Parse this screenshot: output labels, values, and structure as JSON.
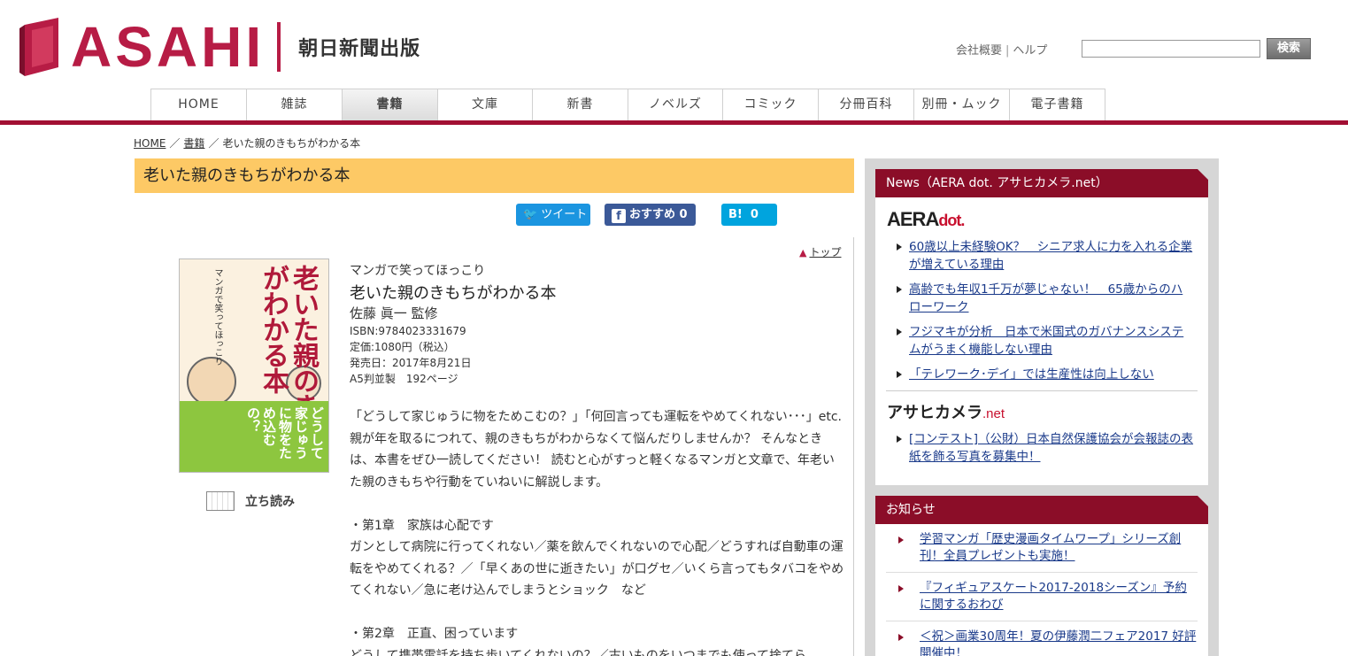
{
  "brand": {
    "logo_text": "ASAHI",
    "subtitle": "朝日新聞出版",
    "accent_color": "#b71c45"
  },
  "utility": {
    "company": "会社概要",
    "separator": "|",
    "help": "ヘルプ",
    "search_placeholder": "",
    "search_button": "検索"
  },
  "nav": {
    "items": [
      {
        "label": "HOME",
        "active": false
      },
      {
        "label": "雑誌",
        "active": false
      },
      {
        "label": "書籍",
        "active": true
      },
      {
        "label": "文庫",
        "active": false
      },
      {
        "label": "新書",
        "active": false
      },
      {
        "label": "ノベルズ",
        "active": false
      },
      {
        "label": "コミック",
        "active": false
      },
      {
        "label": "分冊百科",
        "active": false
      },
      {
        "label": "別冊・ムック",
        "active": false
      },
      {
        "label": "電子書籍",
        "active": false
      }
    ]
  },
  "breadcrumb": {
    "home": "HOME",
    "sep": "／",
    "category": "書籍",
    "current": "老いた親のきもちがわかる本"
  },
  "page_title": "老いた親のきもちがわかる本",
  "social": {
    "tweet": "ツイート",
    "fb_label": "おすすめ",
    "fb_count": "0",
    "hb_label": "B!",
    "hb_count": "0"
  },
  "top_link": "トップ",
  "cover": {
    "title": "老いた親のきもちがわかる本",
    "series": "マンガで笑ってほっこり",
    "band": "どうして家じゅうに物をため込むの？"
  },
  "tachiyomi": "立ち読み",
  "book": {
    "series": "マンガで笑ってほっこり",
    "title": "老いた親のきもちがわかる本",
    "author": "佐藤 眞一 監修",
    "isbn": "ISBN:9784023331679",
    "price": "定価:1080円（税込）",
    "release": "発売日：2017年8月21日",
    "format": "A5判並製　192ページ"
  },
  "description": [
    "「どうして家じゅうに物をためこむの？」「何回言っても運転をやめてくれない･･･」etc. 親が年を取るにつれて、親のきもちがわからなくて悩んだりしませんか？ そんなときは、本書をぜひ一読してください！ 読むと心がすっと軽くなるマンガと文章で、年老いた親のきもちや行動をていねいに解説します。",
    "・第1章　家族は心配です\nガンとして病院に行ってくれない／薬を飲んでくれないので心配／どうすれば自動車の運転をやめてくれる？／「早くあの世に逝きたい」が口グセ／いくら言ってもタバコをやめてくれない／急に老け込んでしまうとショック　など",
    "・第2章　正直、困っています\nどうして携帯電話を持ち歩いてくれないの？／古いものをいつまでも使って捨てら"
  ],
  "sidebar": {
    "news_title": "News（AERA dot. アサヒカメラ.net）",
    "aera_brand": "AERA",
    "aera_brand_suffix": "dot.",
    "aera_items": [
      "60歳以上未経験OK？　シニア求人に力を入れる企業が増えている理由",
      "高齢でも年収1千万が夢じゃない！　65歳からのハローワーク",
      "フジマキが分析　日本で米国式のガバナンスシステムがうまく機能しない理由",
      "「テレワーク･デイ」では生産性は向上しない"
    ],
    "camera_brand": "アサヒカメラ",
    "camera_brand_suffix": ".net",
    "camera_items": [
      "[コンテスト]（公財）日本自然保護協会が会報誌の表紙を飾る写真を募集中！"
    ],
    "notice_title": "お知らせ",
    "notice_items": [
      "学習マンガ「歴史漫画タイムワープ」シリーズ創刊！全員プレゼントも実施！",
      "『フィギュアスケート2017-2018シーズン』予約に関するおわび",
      "＜祝＞画業30周年！夏の伊藤潤二フェア2017 好評開催中！"
    ]
  }
}
